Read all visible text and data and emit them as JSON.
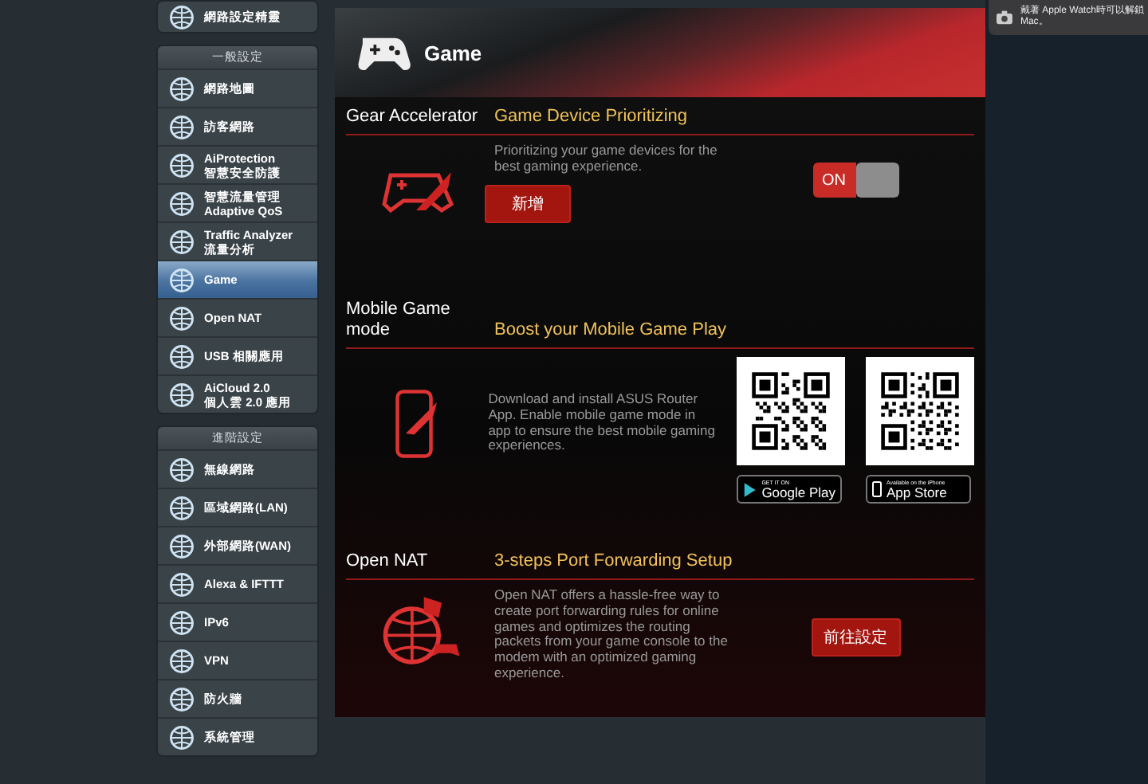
{
  "sidebar": {
    "partial_item": {
      "label": "網路設定精靈"
    },
    "groups": [
      {
        "title": "一般設定",
        "items": [
          {
            "label": "網路地圖",
            "selected": false
          },
          {
            "label": "訪客網路",
            "selected": false
          },
          {
            "label": "AiProtection\n智慧安全防護",
            "selected": false
          },
          {
            "label": "智慧流量管理 Adaptive QoS",
            "selected": false
          },
          {
            "label": "Traffic Analyzer\n流量分析",
            "selected": false
          },
          {
            "label": "Game",
            "selected": true
          },
          {
            "label": "Open NAT",
            "selected": false
          },
          {
            "label": "USB 相關應用",
            "selected": false
          },
          {
            "label": "AiCloud 2.0\n個人雲 2.0 應用",
            "selected": false
          }
        ]
      },
      {
        "title": "進階設定",
        "items": [
          {
            "label": "無線網路",
            "selected": false
          },
          {
            "label": "區域網路(LAN)",
            "selected": false
          },
          {
            "label": "外部網路(WAN)",
            "selected": false
          },
          {
            "label": "Alexa & IFTTT",
            "selected": false
          },
          {
            "label": "IPv6",
            "selected": false
          },
          {
            "label": "VPN",
            "selected": false
          },
          {
            "label": "防火牆",
            "selected": false
          },
          {
            "label": "系統管理",
            "selected": false
          }
        ]
      }
    ]
  },
  "panel": {
    "title": "Game",
    "sections": [
      {
        "kind": "toggle",
        "label": "Gear Accelerator",
        "heading": "Game Device Prioritizing",
        "description": "Prioritizing your game devices for the best gaming experience.",
        "button": "新增",
        "toggle": {
          "text": "ON",
          "on": true
        }
      },
      {
        "kind": "apps",
        "label": "Mobile Game mode",
        "heading": "Boost your Mobile Game Play",
        "description": "Download and install ASUS Router App. Enable mobile game mode in app to ensure the best mobile gaming experiences.",
        "stores": [
          {
            "caption": "GET IT ON",
            "name": "Google Play"
          },
          {
            "caption": "Available on the iPhone",
            "name": "App Store"
          }
        ]
      },
      {
        "kind": "link",
        "label": "Open NAT",
        "heading": "3-steps Port Forwarding Setup",
        "description": "Open NAT offers a hassle-free way to create port forwarding rules for online games and optimizes the routing packets from your game console to the modem with an optimized gaming experience.",
        "button": "前往設定"
      }
    ]
  },
  "notification": {
    "text": "戴著 Apple Watch時可以解鎖 Mac。"
  }
}
